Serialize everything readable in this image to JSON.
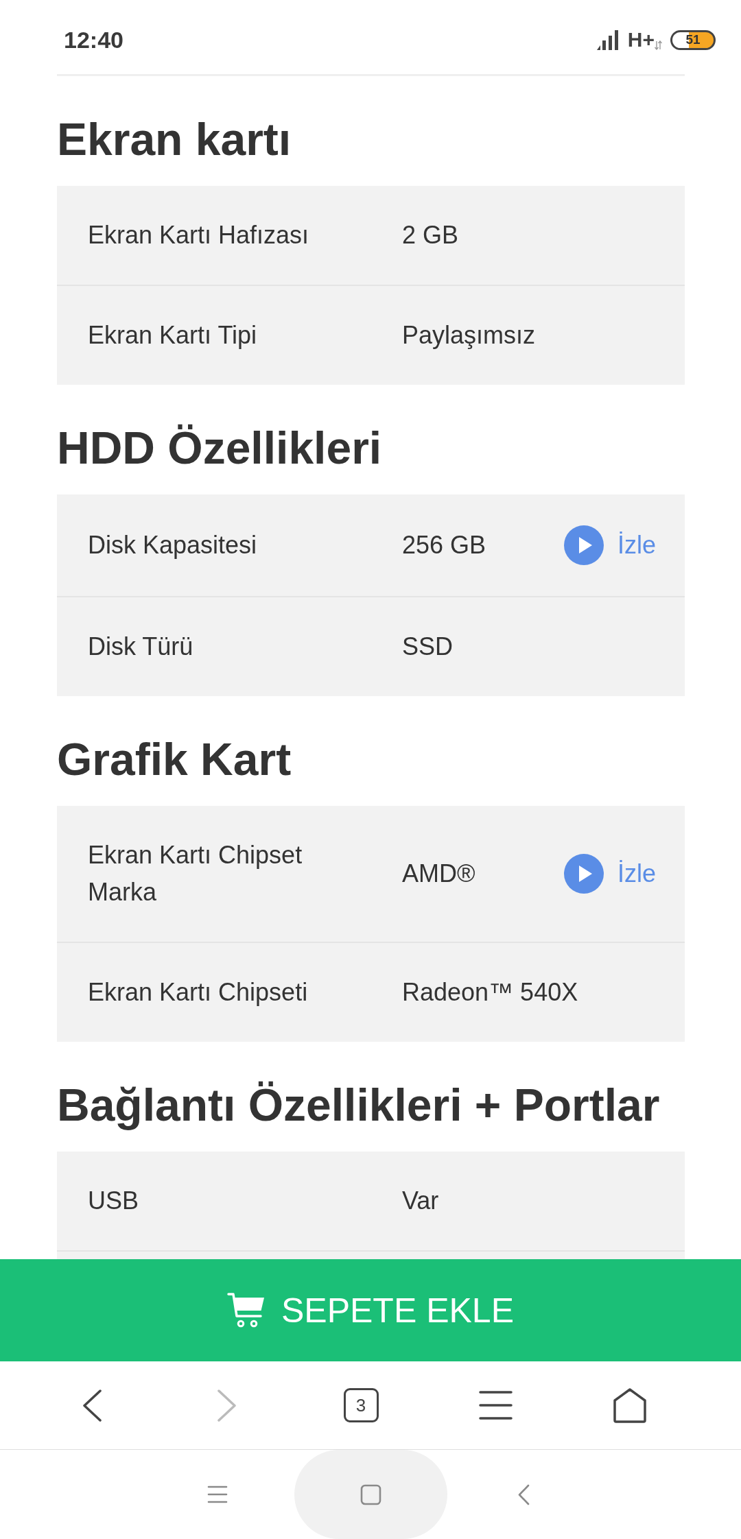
{
  "status_bar": {
    "time": "12:40",
    "network": "H+",
    "battery": "51"
  },
  "sections": [
    {
      "title": "Ekran kartı",
      "rows": [
        {
          "label": "Ekran Kartı Hafızası",
          "value": "2 GB"
        },
        {
          "label": "Ekran Kartı Tipi",
          "value": "Paylaşımsız"
        }
      ]
    },
    {
      "title": "HDD Özellikleri",
      "rows": [
        {
          "label": "Disk Kapasitesi",
          "value": "256 GB",
          "link": "İzle"
        },
        {
          "label": "Disk Türü",
          "value": "SSD"
        }
      ]
    },
    {
      "title": "Grafik Kart",
      "rows": [
        {
          "label": "Ekran Kartı Chipset Marka",
          "value": "AMD®",
          "link": "İzle"
        },
        {
          "label": "Ekran Kartı Chipseti",
          "value": "Radeon™ 540X"
        }
      ]
    },
    {
      "title": "Bağlantı Özellikleri + Portlar",
      "rows": [
        {
          "label": "USB",
          "value": "Var"
        }
      ]
    }
  ],
  "add_to_cart_button": {
    "label": "SEPETE EKLE"
  },
  "browser_toolbar": {
    "buttons": [
      {
        "kind": "back",
        "disabled": false
      },
      {
        "kind": "forward",
        "disabled": true
      },
      {
        "kind": "tabs",
        "label": "3",
        "disabled": false
      },
      {
        "kind": "menu",
        "disabled": false
      },
      {
        "kind": "home",
        "disabled": false
      }
    ]
  },
  "system_nav": {
    "buttons": [
      {
        "kind": "recents",
        "pressed": false
      },
      {
        "kind": "home",
        "pressed": true
      },
      {
        "kind": "back",
        "pressed": false
      }
    ]
  }
}
